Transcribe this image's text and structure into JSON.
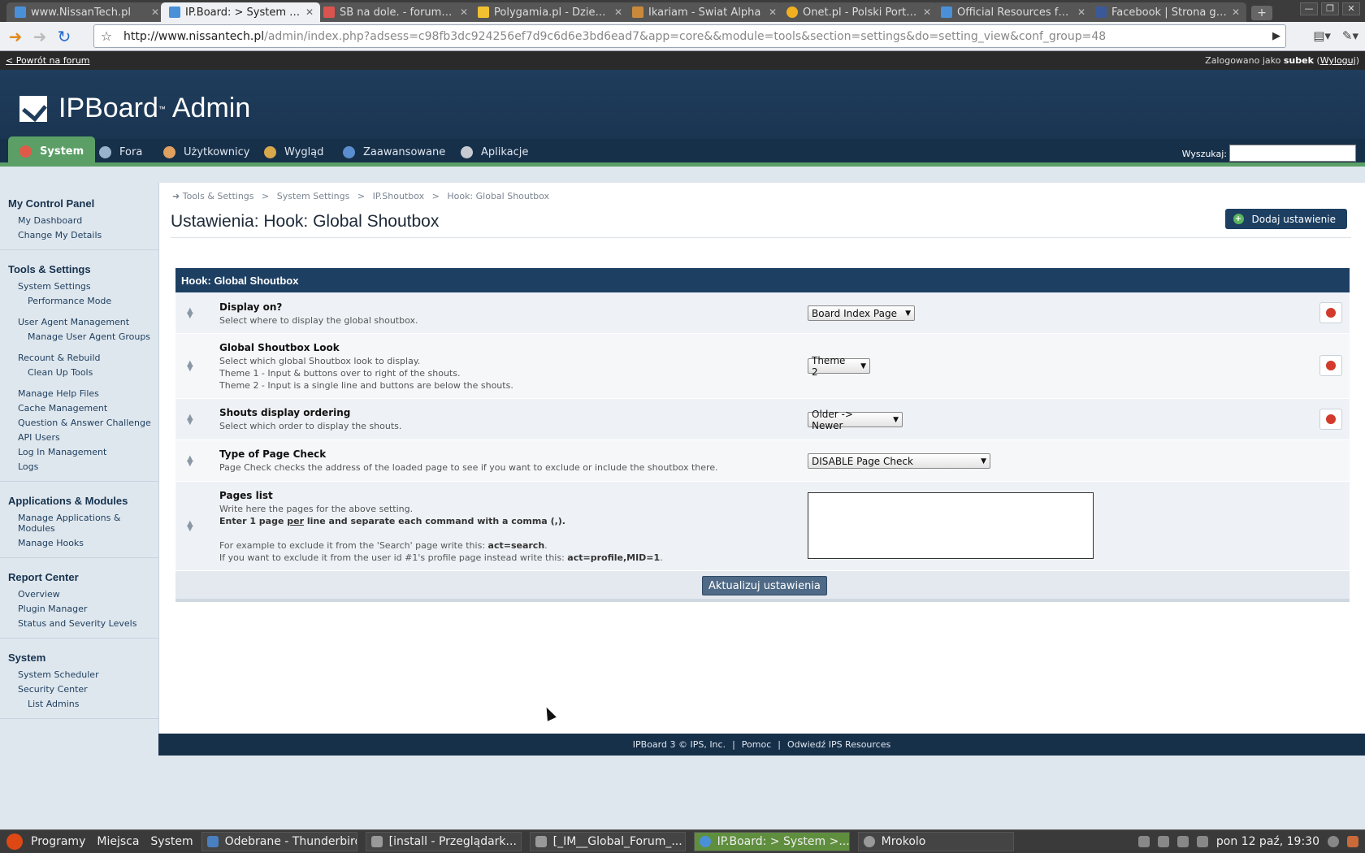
{
  "browser": {
    "tabs": [
      {
        "title": "www.NissanTech.pl",
        "color": "#4a90d9"
      },
      {
        "title": "IP.Board: > System >...",
        "color": "#4a90d9",
        "active": true
      },
      {
        "title": "SB na dole. - forum.in...",
        "color": "#d9534f"
      },
      {
        "title": "Polygamia.pl - Dzienn...",
        "color": "#f0c030"
      },
      {
        "title": "Ikariam - Świat Alpha",
        "color": "#c88a3a"
      },
      {
        "title": "Onet.pl - Polski Portal ...",
        "color": "#f0b020"
      },
      {
        "title": "Official Resources fro...",
        "color": "#4a90d9"
      },
      {
        "title": "Facebook | Strona głó...",
        "color": "#3b5998"
      }
    ],
    "url_host": "http://www.nissantech.pl",
    "url_path": "/admin/index.php?adsess=c98fb3dc924256ef7d9c6d6e3bd6ead7&app=core&&module=tools&section=settings&do=setting_view&conf_group=48"
  },
  "adminbar": {
    "back_link": "< Powrót na forum",
    "logged_prefix": "Zalogowano jako",
    "username": "subek",
    "logout": "Wyloguj"
  },
  "header": {
    "logo_text_1": "IPBoard",
    "tm": "™",
    "logo_text_2": "Admin"
  },
  "nav": {
    "items": [
      {
        "label": "System",
        "active": true
      },
      {
        "label": "Fora"
      },
      {
        "label": "Użytkownicy"
      },
      {
        "label": "Wygląd"
      },
      {
        "label": "Zaawansowane"
      },
      {
        "label": "Aplikacje"
      }
    ],
    "search_label": "Wyszukaj:"
  },
  "sidebar": {
    "sections": [
      {
        "title": "My Control Panel",
        "links": [
          "My Dashboard",
          "Change My Details"
        ]
      },
      {
        "title": "Tools & Settings",
        "links": [
          "System Settings",
          "Performance Mode",
          "User Agent Management",
          "Manage User Agent Groups",
          "Recount & Rebuild",
          "Clean Up Tools",
          "Manage Help Files",
          "Cache Management",
          "Question & Answer Challenge",
          "API Users",
          "Log In Management",
          "Logs"
        ]
      },
      {
        "title": "Applications & Modules",
        "links": [
          "Manage Applications & Modules",
          "Manage Hooks"
        ]
      },
      {
        "title": "Report Center",
        "links": [
          "Overview",
          "Plugin Manager",
          "Status and Severity Levels"
        ]
      },
      {
        "title": "System",
        "links": [
          "System Scheduler",
          "Security Center",
          "List Admins"
        ]
      }
    ]
  },
  "content": {
    "breadcrumbs": [
      "Tools & Settings",
      "System Settings",
      "IP.Shoutbox",
      "Hook: Global Shoutbox"
    ],
    "crumb_sep": ">",
    "page_title": "Ustawienia: Hook: Global Shoutbox",
    "add_button": "Dodaj ustawienie",
    "group_title": "Hook: Global Shoutbox",
    "settings": [
      {
        "title": "Display on?",
        "desc": [
          "Select where to display the global shoutbox."
        ],
        "value": "Board Index Page"
      },
      {
        "title": "Global Shoutbox Look",
        "desc": [
          "Select which global Shoutbox look to display.",
          "Theme 1 - Input & buttons over to right of the shouts.",
          "Theme 2 - Input is a single line and buttons are below the shouts."
        ],
        "value": "Theme 2"
      },
      {
        "title": "Shouts display ordering",
        "desc": [
          "Select which order to display the shouts."
        ],
        "value": "Older -> Newer"
      },
      {
        "title": "Type of Page Check",
        "desc": [
          "Page Check checks the address of the loaded page to see if you want to exclude or include the shoutbox there."
        ],
        "value": "DISABLE Page Check"
      },
      {
        "title": "Pages list",
        "desc_1": "Write here the pages for the above setting.",
        "desc_2a": "Enter 1 page ",
        "desc_2b": "per",
        "desc_2c": " line and separate each command with a comma (,).",
        "desc_3a": "For example to exclude it from the 'Search' page write this: ",
        "desc_3b": "act=search",
        "desc_3c": ".",
        "desc_4a": "If you want to exclude it from the user id #1's profile page instead write this: ",
        "desc_4b": "act=profile,MID=1",
        "desc_4c": "."
      }
    ],
    "submit": "Aktualizuj ustawienia"
  },
  "footer": {
    "copyright": "IPBoard 3 © IPS, Inc.",
    "help": "Pomoc",
    "resources": "Odwiedź IPS Resources",
    "sep": "|"
  },
  "taskbar": {
    "menus": [
      "Programy",
      "Miejsca",
      "System"
    ],
    "tasks": [
      {
        "label": "Odebrane - Thunderbird"
      },
      {
        "label": "[install - Przeglądark..."
      },
      {
        "label": "[_IM__Global_Forum_..."
      },
      {
        "label": "IP.Board: > System >...",
        "active": true
      },
      {
        "label": "Mrokolo"
      }
    ],
    "clock": "pon 12 paź, 19:30"
  },
  "colors": {
    "nav_active": "#5b9f66",
    "header_bg": "#1f3d5c",
    "accent_dark": "#1c3f62",
    "revert_red": "#d23a2c"
  }
}
